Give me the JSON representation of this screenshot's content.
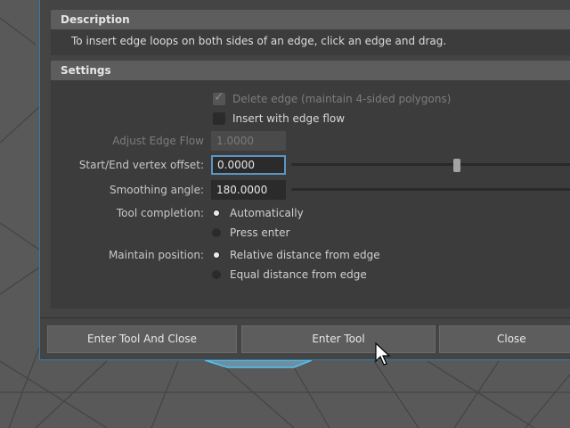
{
  "description": {
    "header": "Description",
    "text": "To insert edge loops on both sides of an edge, click an edge and drag."
  },
  "settings": {
    "header": "Settings",
    "delete_edge": {
      "label": "Delete edge (maintain 4-sided polygons)",
      "checked": true,
      "enabled": false
    },
    "insert_edge_flow": {
      "label": "Insert with edge flow",
      "checked": false
    },
    "adjust_edge_flow": {
      "label": "Adjust Edge Flow",
      "value": "1.0000",
      "enabled": false
    },
    "vertex_offset": {
      "label": "Start/End vertex offset:",
      "value": "0.0000"
    },
    "smoothing_angle": {
      "label": "Smoothing angle:",
      "value": "180.0000"
    },
    "tool_completion": {
      "label": "Tool completion:",
      "options": [
        "Automatically",
        "Press enter"
      ],
      "selected": "Automatically"
    },
    "maintain_position": {
      "label": "Maintain position:",
      "options": [
        "Relative distance from edge",
        "Equal distance from edge"
      ],
      "selected": "Relative distance from edge"
    }
  },
  "buttons": {
    "enter_tool_and_close": "Enter Tool And Close",
    "enter_tool": "Enter Tool",
    "close": "Close"
  },
  "colors": {
    "dialog_bg": "#444444",
    "panel_bg": "#3c3c3c",
    "header_bg": "#5d5d5d",
    "accent_border": "#2e7fb0",
    "focus_border": "#5b95c4"
  }
}
